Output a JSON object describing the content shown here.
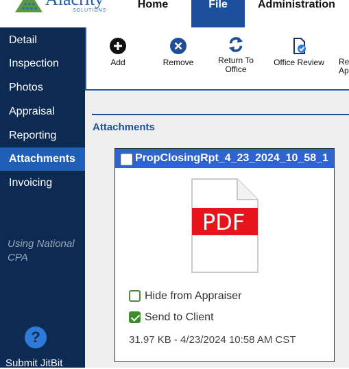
{
  "header": {
    "brand": "Alacrity",
    "brand_sub": "SOLUTIONS",
    "nav": [
      {
        "label": "Home"
      },
      {
        "label": "File"
      },
      {
        "label": "Administration"
      }
    ],
    "active_nav": "File"
  },
  "sidebar": {
    "items": [
      {
        "label": "Detail"
      },
      {
        "label": "Inspection"
      },
      {
        "label": "Photos"
      },
      {
        "label": "Appraisal"
      },
      {
        "label": "Reporting"
      },
      {
        "label": "Attachments"
      },
      {
        "label": "Invoicing"
      }
    ],
    "active_item": "Attachments",
    "note": "Using National CPA",
    "help_glyph": "?",
    "submit_label": "Submit JitBit"
  },
  "toolbar": {
    "buttons": [
      {
        "label": "Add",
        "icon": "plus-circle-icon"
      },
      {
        "label": "Remove",
        "icon": "x-circle-icon"
      },
      {
        "label": "Return To Office",
        "icon": "refresh-arrows-icon"
      },
      {
        "label": "Office Review",
        "icon": "document-check-icon"
      },
      {
        "label": "Re Ap",
        "icon": "partial-icon"
      }
    ]
  },
  "main": {
    "section_title": "Attachments",
    "attachment": {
      "file_name": "PropClosingRpt_4_23_2024_10_58_1",
      "icon_text": "PDF",
      "options": [
        {
          "label": "Hide from Appraiser",
          "checked": false
        },
        {
          "label": "Send to Client",
          "checked": true
        }
      ],
      "meta": "31.97 KB - 4/23/2024 10:58 AM CST"
    }
  },
  "colors": {
    "sidebar_bg": "#0d2a52",
    "active_blue": "#1f5fb8",
    "card_header": "#2f63d1",
    "pdf_red": "#e8141c",
    "check_green": "#3d8d2e"
  }
}
